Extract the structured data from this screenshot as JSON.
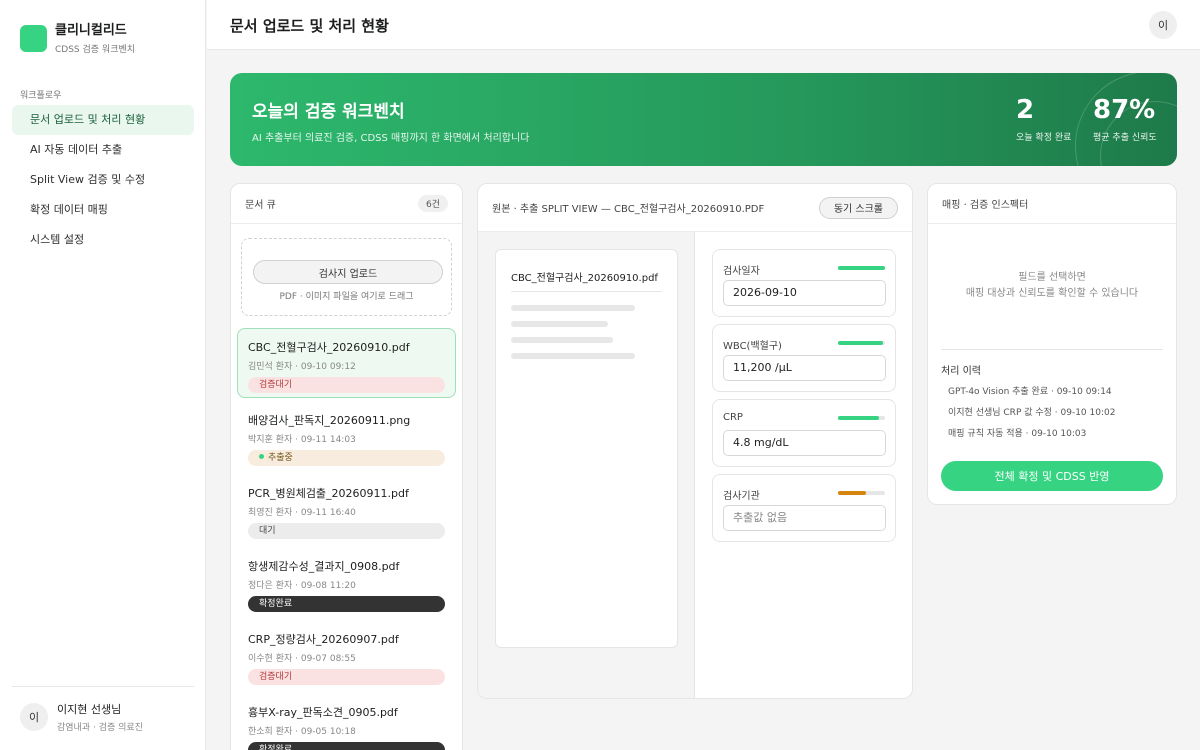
{
  "brand": {
    "name": "클리니컬리드",
    "subtitle": "CDSS 검증 워크벤치"
  },
  "sidebar": {
    "section_label": "워크플로우",
    "items": [
      {
        "label": "문서 업로드 및 처리 현황"
      },
      {
        "label": "AI 자동 데이터 추출"
      },
      {
        "label": "Split View 검증 및 수정"
      },
      {
        "label": "확정 데이터 매핑"
      },
      {
        "label": "시스템 설정"
      }
    ],
    "user": {
      "avatar": "이",
      "name": "이지현 선생님",
      "role": "감염내과 · 검증 의료진"
    }
  },
  "header": {
    "title": "문서 업로드 및 처리 현황",
    "avatar": "이"
  },
  "hero": {
    "title": "오늘의 검증 워크벤치",
    "subtitle": "AI 추출부터 의료진 검증, CDSS 매핑까지 한 화면에서 처리합니다",
    "stats": [
      {
        "value": "2",
        "label": "오늘 확정 완료"
      },
      {
        "value": "87%",
        "label": "평균 추출 신뢰도"
      }
    ]
  },
  "queue": {
    "title": "문서 큐",
    "count": "6건",
    "upload_button": "검사지 업로드",
    "upload_hint": "PDF · 이미지 파일을 여기로 드래그",
    "docs": [
      {
        "name": "CBC_전혈구검사_20260910.pdf",
        "meta": "김민석 환자 · 09-10 09:12",
        "status": "검증대기"
      },
      {
        "name": "배양검사_판독지_20260911.png",
        "meta": "박지훈 환자 · 09-11 14:03",
        "status": "추출중"
      },
      {
        "name": "PCR_병원체검출_20260911.pdf",
        "meta": "최영진 환자 · 09-11 16:40",
        "status": "대기"
      },
      {
        "name": "항생제감수성_결과지_0908.pdf",
        "meta": "정다은 환자 · 09-08 11:20",
        "status": "확정완료"
      },
      {
        "name": "CRP_정량검사_20260907.pdf",
        "meta": "이수현 환자 · 09-07 08:55",
        "status": "검증대기"
      },
      {
        "name": "흉부X-ray_판독소견_0905.pdf",
        "meta": "한소희 환자 · 09-05 10:18",
        "status": "확정완료"
      }
    ]
  },
  "split_view": {
    "title": "원본 · 추출 SPLIT VIEW — CBC_전혈구검사_20260910.PDF",
    "sync_button": "동기 스크롤",
    "preview_title": "CBC_전혈구검사_20260910.pdf",
    "fields": [
      {
        "label": "검사일자",
        "value": "2026-09-10",
        "confidence": 1.0,
        "color": "#36d382"
      },
      {
        "label": "WBC(백혈구)",
        "value": "11,200 /μL",
        "confidence": 0.95,
        "color": "#36d382"
      },
      {
        "label": "CRP",
        "value": "4.8 mg/dL",
        "confidence": 0.88,
        "color": "#36d382"
      },
      {
        "label": "검사기관",
        "value": "추출값 없음",
        "confidence": 0.6,
        "color": "#d6860f"
      }
    ]
  },
  "inspector": {
    "title": "매핑 · 검증 인스펙터",
    "empty_line1": "필드를 선택하면",
    "empty_line2": "매핑 대상과 신뢰도를 확인할 수 있습니다",
    "history_title": "처리 이력",
    "history": [
      "GPT-4o Vision 추출 완료 · 09-10 09:14",
      "이지현 선생님 CRP 값 수정 · 09-10 10:02",
      "매핑 규칙 자동 적용 · 09-10 10:03"
    ],
    "confirm_button": "전체 확정 및 CDSS 반영"
  }
}
